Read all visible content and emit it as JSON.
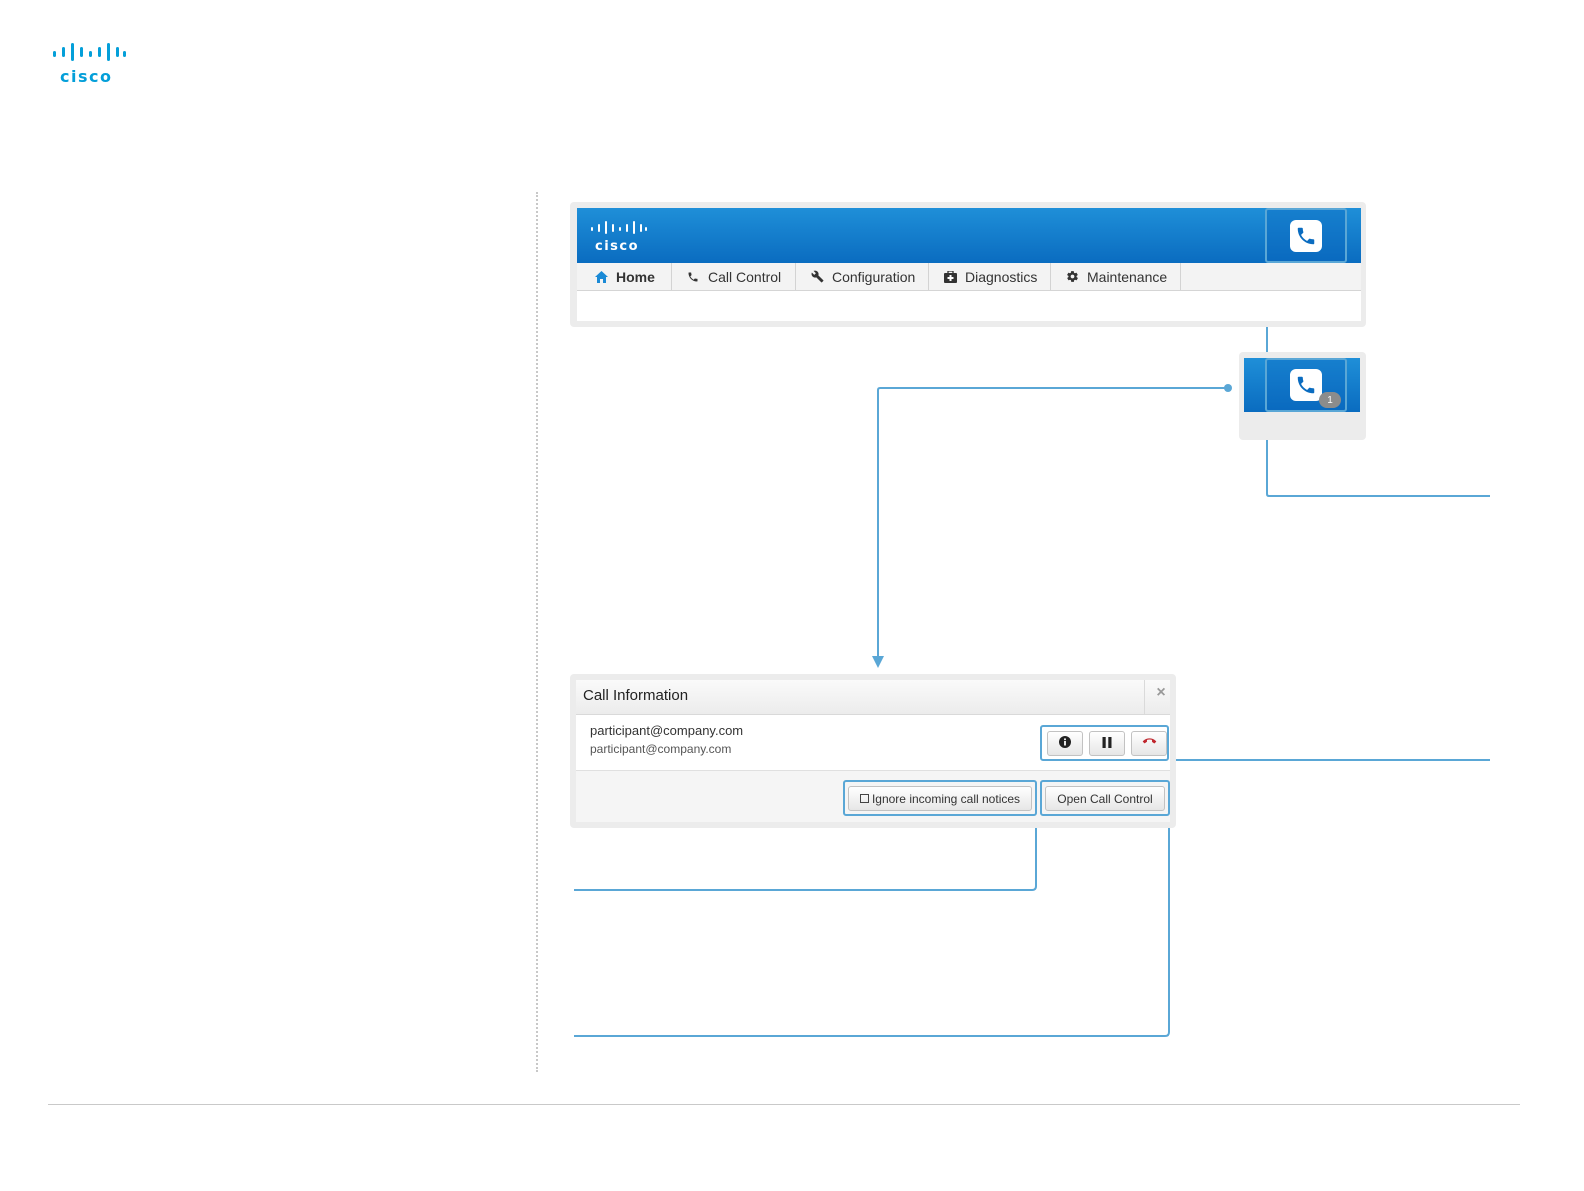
{
  "page_logo": {
    "text": "cisco"
  },
  "web_ui": {
    "logo_text": "cisco",
    "nav": [
      {
        "label": "Home",
        "icon": "home-icon"
      },
      {
        "label": "Call Control",
        "icon": "phone-icon"
      },
      {
        "label": "Configuration",
        "icon": "wrench-icon"
      },
      {
        "label": "Diagnostics",
        "icon": "medkit-icon"
      },
      {
        "label": "Maintenance",
        "icon": "gear-icon"
      }
    ],
    "call_button_icon": "phone-icon"
  },
  "notification": {
    "call_button_icon": "phone-icon",
    "badge_count": "1"
  },
  "dialog": {
    "title": "Call Information",
    "close_glyph": "×",
    "callee_primary": "participant@company.com",
    "callee_secondary": "participant@company.com",
    "actions": [
      {
        "name": "info",
        "icon": "info-icon"
      },
      {
        "name": "hold",
        "icon": "pause-icon"
      },
      {
        "name": "hang-up",
        "icon": "hang-up-icon"
      }
    ],
    "ignore_label": "Ignore incoming call notices",
    "open_label": "Open Call Control"
  },
  "colors": {
    "brand_blue": "#0a6cc0",
    "cisco_cyan": "#049fd9",
    "callout_line": "#5aa7d6",
    "hangup_red": "#c0262d"
  }
}
